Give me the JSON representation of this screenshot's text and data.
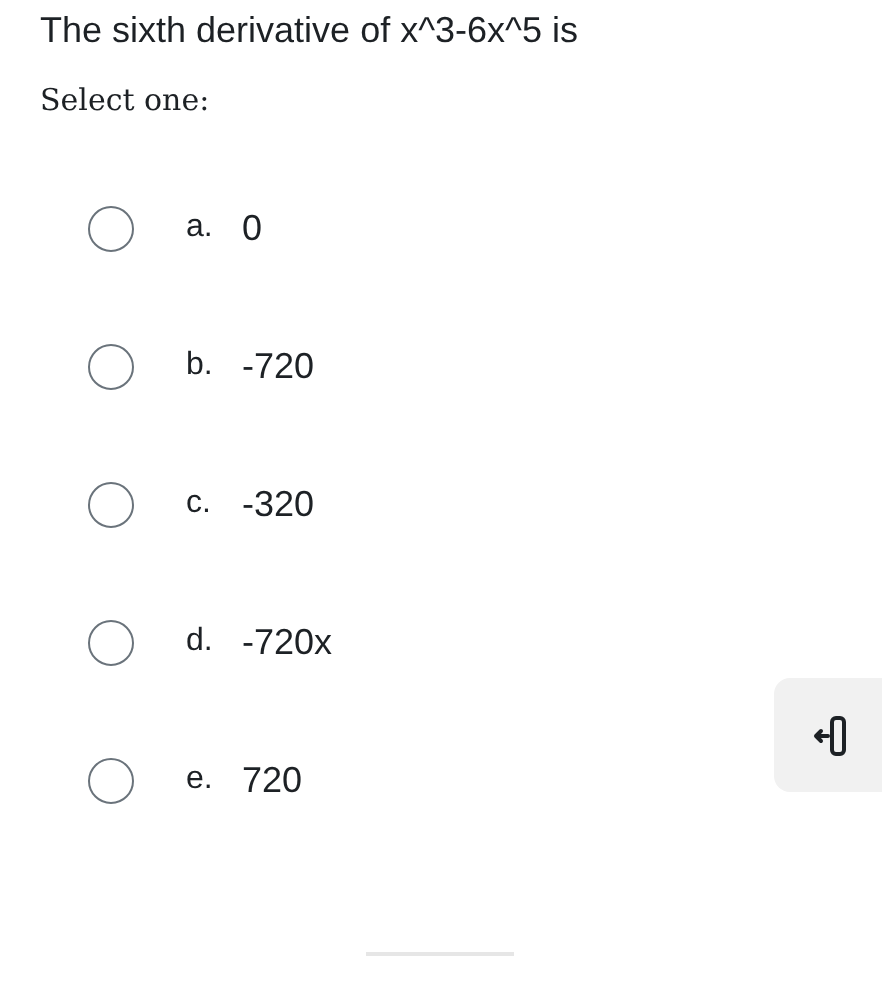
{
  "question": "The sixth derivative of x^3-6x^5 is",
  "prompt": "Select one:",
  "options": [
    {
      "letter": "a.",
      "text": "0",
      "selected": false
    },
    {
      "letter": "b.",
      "text": "-720",
      "selected": false
    },
    {
      "letter": "c.",
      "text": "-320",
      "selected": false
    },
    {
      "letter": "d.",
      "text": "-720x",
      "selected": false
    },
    {
      "letter": "e.",
      "text": "720",
      "selected": false
    }
  ]
}
